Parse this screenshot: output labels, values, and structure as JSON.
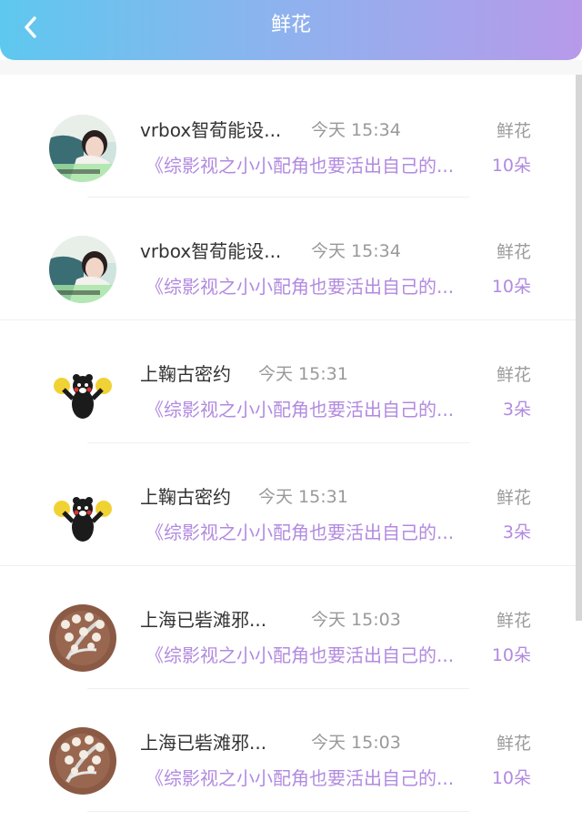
{
  "header": {
    "title": "鲜花"
  },
  "items": [
    {
      "name": "vrbox智荀能设...",
      "time": "今天 15:34",
      "kind": "鲜花",
      "desc": "《综影视之小小配角也要活出自己的...",
      "count": "10朵",
      "avatar": "woman-portrait"
    },
    {
      "name": "vrbox智荀能设...",
      "time": "今天 15:34",
      "kind": "鲜花",
      "desc": "《综影视之小小配角也要活出自己的...",
      "count": "10朵",
      "avatar": "woman-portrait"
    },
    {
      "name": "上鞠古密约",
      "time": "今天 15:31",
      "kind": "鲜花",
      "desc": "《综影视之小小配角也要活出自己的...",
      "count": "3朵",
      "avatar": "bear-cheerleader"
    },
    {
      "name": "上鞠古密约",
      "time": "今天 15:31",
      "kind": "鲜花",
      "desc": "《综影视之小小配角也要活出自己的...",
      "count": "3朵",
      "avatar": "bear-cheerleader"
    },
    {
      "name": "上海已砦滩邪...",
      "time": "今天 15:03",
      "kind": "鲜花",
      "desc": "《综影视之小小配角也要活出自己的...",
      "count": "10朵",
      "avatar": "pearl-brooch"
    },
    {
      "name": "上海已砦滩邪...",
      "time": "今天 15:03",
      "kind": "鲜花",
      "desc": "《综影视之小小配角也要活出自己的...",
      "count": "10朵",
      "avatar": "pearl-brooch"
    }
  ]
}
